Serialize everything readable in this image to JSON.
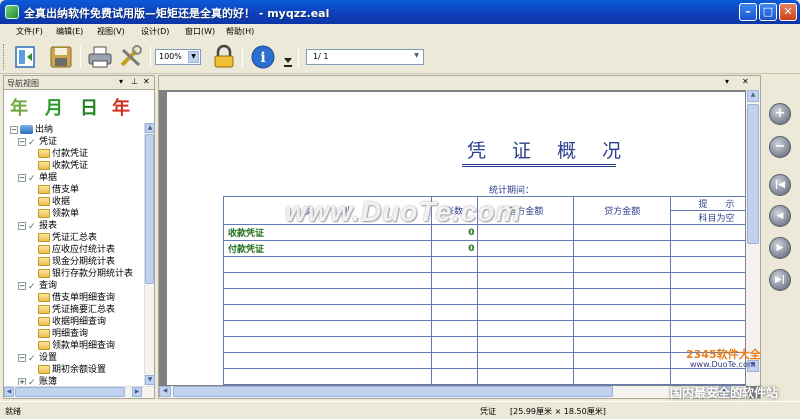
{
  "window": {
    "title": "全真出纳软件免费试用版—矩矩还是全真的好！ - myqzz.eal"
  },
  "menu": [
    "文件(F)",
    "编辑(E)",
    "视图(V)",
    "设计(D)",
    "窗口(W)",
    "帮助(H)"
  ],
  "toolbar": {
    "zoom": "100%",
    "page": "1/ 1"
  },
  "nav": {
    "title": "导航视图",
    "date_buttons": [
      "年",
      "月",
      "日",
      "年"
    ],
    "tree": [
      {
        "label": "出纳",
        "level": 0,
        "type": "root"
      },
      {
        "label": "凭证",
        "level": 1,
        "type": "group"
      },
      {
        "label": "付款凭证",
        "level": 2,
        "type": "leaf"
      },
      {
        "label": "收款凭证",
        "level": 2,
        "type": "leaf"
      },
      {
        "label": "单据",
        "level": 1,
        "type": "group"
      },
      {
        "label": "借支单",
        "level": 2,
        "type": "leaf"
      },
      {
        "label": "收据",
        "level": 2,
        "type": "leaf"
      },
      {
        "label": "领款单",
        "level": 2,
        "type": "leaf"
      },
      {
        "label": "报表",
        "level": 1,
        "type": "group"
      },
      {
        "label": "凭证汇总表",
        "level": 2,
        "type": "leaf"
      },
      {
        "label": "应收应付统计表",
        "level": 2,
        "type": "leaf"
      },
      {
        "label": "现金分期统计表",
        "level": 2,
        "type": "leaf"
      },
      {
        "label": "银行存款分期统计表",
        "level": 2,
        "type": "leaf"
      },
      {
        "label": "查询",
        "level": 1,
        "type": "group"
      },
      {
        "label": "借支单明细查询",
        "level": 2,
        "type": "leaf"
      },
      {
        "label": "凭证摘要汇总表",
        "level": 2,
        "type": "leaf"
      },
      {
        "label": "收据明细查询",
        "level": 2,
        "type": "leaf"
      },
      {
        "label": "明细查询",
        "level": 2,
        "type": "leaf"
      },
      {
        "label": "领款单明细查询",
        "level": 2,
        "type": "leaf"
      },
      {
        "label": "设置",
        "level": 1,
        "type": "group"
      },
      {
        "label": "期初余额设置",
        "level": 2,
        "type": "leaf"
      },
      {
        "label": "账簿",
        "level": 1,
        "type": "group"
      }
    ]
  },
  "doc": {
    "title": "凭 证 概 况",
    "period_label": "统计期间：",
    "columns": [
      "类　　　别",
      "张数",
      "借方金额",
      "贷方金额",
      "提　　示"
    ],
    "subheader": "科目为空",
    "rows": [
      {
        "name": "收款凭证",
        "count": "0"
      },
      {
        "name": "付款凭证",
        "count": "0"
      }
    ]
  },
  "status": {
    "left": "就绪",
    "middle": "凭证",
    "size": "[25.99厘米 × 18.50厘米]"
  },
  "watermarks": {
    "main": "www.DuoTe.com",
    "logo": "2345软件大全",
    "logo_url": "www.DuoTe.com",
    "slogan": "国内最安全的软件站"
  }
}
